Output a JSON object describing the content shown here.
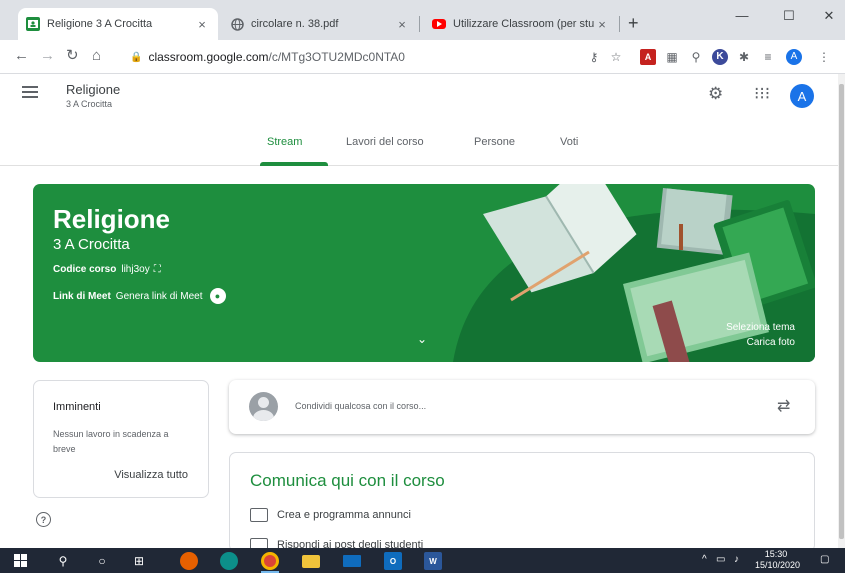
{
  "browser": {
    "tabs": [
      {
        "title": "Religione 3 A Crocitta",
        "active": true,
        "icon": "classroom-icon"
      },
      {
        "title": "circolare n. 38.pdf",
        "active": false,
        "icon": "globe-icon"
      },
      {
        "title": "Utilizzare Classroom (per studenti",
        "active": false,
        "icon": "youtube-icon"
      }
    ],
    "close_glyph": "×",
    "new_tab_glyph": "+",
    "window_minimize": "—",
    "window_maximize": "☐",
    "window_close": "✕",
    "url_host": "classroom.google.com",
    "url_path": "/c/MTg3OTU2MDc0NTA0",
    "profile_initial": "A",
    "extension_k_label": "K",
    "extension_pdf_label": "A"
  },
  "classroom": {
    "class_name": "Religione",
    "class_section": "3 A Crocitta",
    "header_avatar": "A",
    "nav_tabs": [
      "Stream",
      "Lavori del corso",
      "Persone",
      "Voti"
    ],
    "active_tab": "Stream",
    "accent_color": "#1e8e3e"
  },
  "banner": {
    "title": "Religione",
    "subtitle": "3 A Crocitta",
    "course_code_label": "Codice corso",
    "course_code": "lihj3oy",
    "meet_label": "Link di Meet",
    "meet_action": "Genera link di Meet",
    "select_theme": "Seleziona tema",
    "upload_photo": "Carica foto"
  },
  "upcoming": {
    "title": "Imminenti",
    "empty_text": "Nessun lavoro in scadenza a breve",
    "view_all": "Visualizza tutto"
  },
  "share": {
    "placeholder": "Condividi qualcosa con il corso..."
  },
  "communicate": {
    "title": "Comunica qui con il corso",
    "items": [
      "Crea e programma annunci",
      "Rispondi ai post degli studenti"
    ]
  },
  "taskbar": {
    "time": "15:30",
    "date": "15/10/2020",
    "outlook_label": "O",
    "word_label": "W"
  }
}
